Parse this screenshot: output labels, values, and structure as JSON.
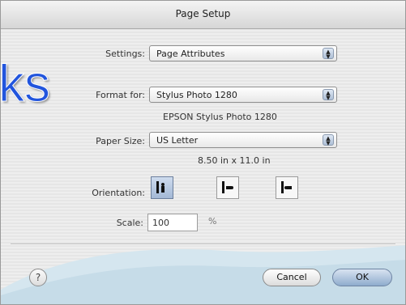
{
  "window": {
    "title": "Page Setup"
  },
  "settings": {
    "label": "Settings:",
    "value": "Page Attributes"
  },
  "format_for": {
    "label": "Format for:",
    "value": "Stylus Photo 1280",
    "printer_description": "EPSON Stylus Photo 1280"
  },
  "paper_size": {
    "label": "Paper Size:",
    "value": "US Letter",
    "dimensions": "8.50 in x 11.0 in"
  },
  "orientation": {
    "label": "Orientation:",
    "options": [
      {
        "name": "portrait",
        "icon": "portrait-orientation-icon",
        "selected": true
      },
      {
        "name": "landscape-left",
        "icon": "landscape-left-icon",
        "selected": false
      },
      {
        "name": "landscape-right",
        "icon": "landscape-right-icon",
        "selected": false
      }
    ]
  },
  "scale": {
    "label": "Scale:",
    "value": "100",
    "unit": "%"
  },
  "buttons": {
    "help": "?",
    "cancel": "Cancel",
    "ok": "OK"
  },
  "overlay_text": "ks",
  "colors": {
    "accent": "#2255dd",
    "default_button": "#8faccd",
    "wave": "#d5e6ef"
  }
}
